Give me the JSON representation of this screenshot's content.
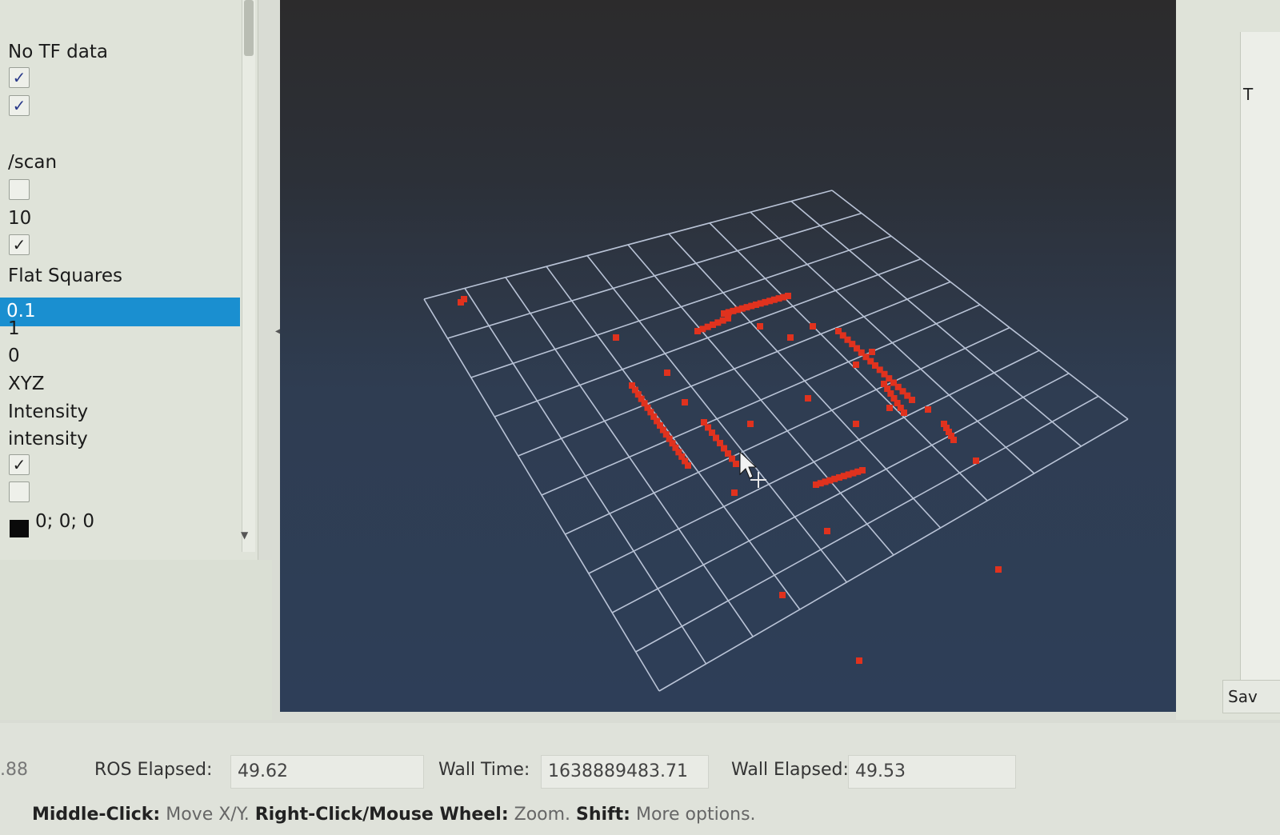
{
  "left_panel": {
    "status_text": "No TF data",
    "topic": "/scan",
    "queue_size": "10",
    "style": "Flat Squares",
    "size_selected": "0.1",
    "alpha": "1",
    "decay_time": "0",
    "position_transformer": "XYZ",
    "color_transformer": "Intensity",
    "channel_name": "intensity",
    "min_color_value": "0; 0; 0"
  },
  "time_bar": {
    "ros_time_partial": ".88",
    "ros_elapsed_label": "ROS Elapsed:",
    "ros_elapsed": "49.62",
    "wall_time_label": "Wall Time:",
    "wall_time": "1638889483.71",
    "wall_elapsed_label": "Wall Elapsed:",
    "wall_elapsed": "49.53"
  },
  "hint_bar": {
    "middle_click_label": "Middle-Click:",
    "middle_click_action": "Move X/Y.",
    "right_click_label": "Right-Click/Mouse Wheel:",
    "right_click_action": "Zoom.",
    "shift_label": "Shift:",
    "shift_action": "More options."
  },
  "right_panel": {
    "tab_label": "T",
    "save_label": "Sav"
  },
  "colors": {
    "selection": "#1a8fd0",
    "grid": "#b9c3d6",
    "scan_points": "#e0321e"
  }
}
